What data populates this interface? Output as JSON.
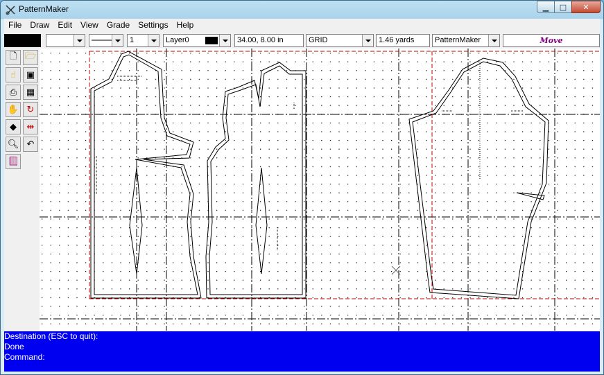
{
  "window": {
    "title": "PatternMaker"
  },
  "menu": [
    "File",
    "Draw",
    "Edit",
    "View",
    "Grade",
    "Settings",
    "Help"
  ],
  "toolbar": {
    "line_width": "1",
    "layer": "Layer0",
    "coordinates": "34.00, 8.00 in",
    "snap": "GRID",
    "fabric": "1.46 yards",
    "style": "PatternMaker",
    "mode": "Move"
  },
  "tools": [
    "new-file-icon",
    "open-folder-icon",
    "hand-pointer-icon",
    "save-disk-icon",
    "print-icon",
    "calculator-icon",
    "pan-hand-icon",
    "rotate-icon",
    "eraser-icon",
    "measure-icon",
    "zoom-icon",
    "undo-icon",
    "book-icon"
  ],
  "command_lines": {
    "line1": "Destination (ESC to quit):",
    "line2": "Done",
    "line3": "Command:"
  },
  "colors": {
    "command_bg": "#0000f0",
    "mode_text": "#800080",
    "guide_red": "#c00000"
  }
}
